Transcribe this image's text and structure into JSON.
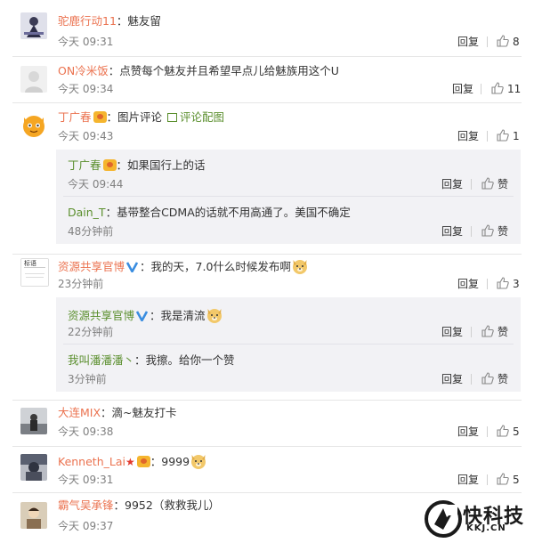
{
  "comments": [
    {
      "name": "驼鹿行动11",
      "text": "：魅友留",
      "time": "今天 09:31",
      "reply": "回复",
      "likes": "8"
    },
    {
      "name": "ON冷米饭",
      "text": "：点赞每个魅友并且希望早点儿给魅族用这个U",
      "time": "今天 09:34",
      "reply": "回复",
      "likes": "11"
    },
    {
      "name": "丁广春",
      "text": "：图片评论",
      "pic_link": "评论配图",
      "time": "今天 09:43",
      "reply": "回复",
      "likes": "1",
      "replies": [
        {
          "name": "丁广春",
          "text": "：如果国行上的话",
          "time": "今天 09:44",
          "reply": "回复",
          "like": "赞"
        },
        {
          "name": "Dain_T",
          "text": "：基带整合CDMA的话就不用高通了。美国不确定",
          "time": "48分钟前",
          "reply": "回复",
          "like": "赞"
        }
      ]
    },
    {
      "name": "资源共享官博",
      "text": "：我的天，7.0什么时候发布啊",
      "time": "23分钟前",
      "reply": "回复",
      "likes": "3",
      "replies": [
        {
          "name": "资源共享官博",
          "text": "：我是清流",
          "time": "22分钟前",
          "reply": "回复",
          "like": "赞"
        },
        {
          "name": "我叫潘潘潘丶",
          "text": "：我擦。给你一个赞",
          "time": "3分钟前",
          "reply": "回复",
          "like": "赞"
        }
      ]
    },
    {
      "name": "大连MIX",
      "text": "：滴~魅友打卡",
      "time": "今天 09:38",
      "reply": "回复",
      "likes": "5"
    },
    {
      "name": "Kenneth_Lai",
      "text": "：9999",
      "time": "今天 09:31",
      "reply": "回复",
      "likes": "5"
    },
    {
      "name": "霸气吴承锋",
      "text": "：9952（救救我儿）",
      "time": "今天 09:37",
      "reply": "回复",
      "likes": ""
    }
  ],
  "avatar4_text": "标语",
  "watermark": {
    "title": "快科技",
    "sub": "KKJ.CN"
  },
  "colors": {
    "name": "#eb7350",
    "reply_name": "#5b8f2e",
    "time": "#808080",
    "subbox_bg": "#f2f2f5"
  }
}
